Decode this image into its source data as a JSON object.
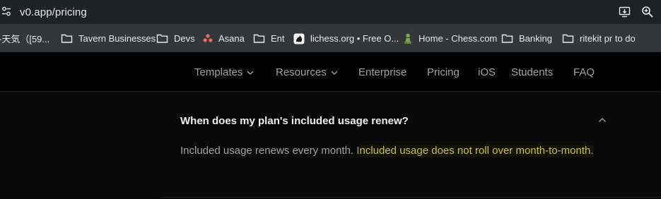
{
  "browser": {
    "url": "v0.app/pricing",
    "icons": {
      "site_settings": "tune-icon",
      "install": "install-app-icon",
      "zoom": "zoom-in-icon"
    }
  },
  "bookmarks": [
    {
      "label": "-天気（[59...",
      "icon": "none"
    },
    {
      "label": "Tavern Businesses",
      "icon": "folder-icon"
    },
    {
      "label": "Devs",
      "icon": "folder-icon"
    },
    {
      "label": "Asana",
      "icon": "asana-icon"
    },
    {
      "label": "Ent",
      "icon": "folder-icon"
    },
    {
      "label": "lichess.org • Free O...",
      "icon": "lichess-icon"
    },
    {
      "label": "Home - Chess.com",
      "icon": "chess-pawn-icon"
    },
    {
      "label": "Banking",
      "icon": "folder-icon"
    },
    {
      "label": "ritekit pr to do",
      "icon": "folder-icon"
    }
  ],
  "nav": {
    "templates": "Templates",
    "resources": "Resources",
    "enterprise": "Enterprise",
    "pricing": "Pricing",
    "ios": "iOS",
    "students": "Students",
    "faq": "FAQ"
  },
  "faq": {
    "question": "When does my plan's included usage renew?",
    "answer_part1": "Included usage renews every month. I",
    "answer_highlight": "ncluded usage does not roll over month-to-month."
  },
  "colors": {
    "page_bg": "#000000",
    "faq_bg": "#0a0a0a",
    "highlight_text": "#c7c14a",
    "muted_text": "#a1a1a1"
  }
}
